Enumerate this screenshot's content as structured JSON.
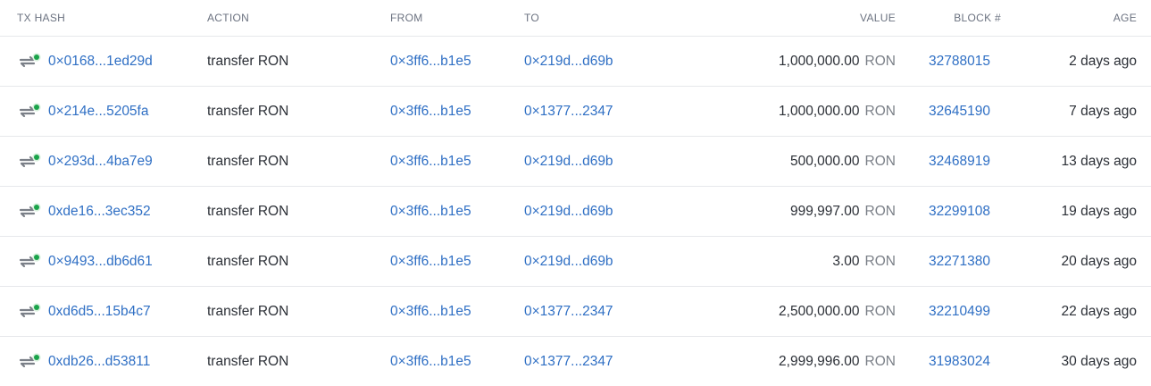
{
  "headers": {
    "tx_hash": "TX HASH",
    "action": "ACTION",
    "from": "FROM",
    "to": "TO",
    "value": "VALUE",
    "block": "BLOCK #",
    "age": "AGE"
  },
  "colors": {
    "link": "#2f6fc4",
    "status_success": "#1aa34a",
    "icon_gray": "#7a7f87"
  },
  "rows": [
    {
      "icon": "transfer-icon",
      "status": "success",
      "hash": "0×0168...1ed29d",
      "action": "transfer RON",
      "from": "0×3ff6...b1e5",
      "to": "0×219d...d69b",
      "value": "1,000,000.00",
      "unit": "RON",
      "block": "32788015",
      "age": "2 days ago"
    },
    {
      "icon": "transfer-icon",
      "status": "success",
      "hash": "0×214e...5205fa",
      "action": "transfer RON",
      "from": "0×3ff6...b1e5",
      "to": "0×1377...2347",
      "value": "1,000,000.00",
      "unit": "RON",
      "block": "32645190",
      "age": "7 days ago"
    },
    {
      "icon": "transfer-icon",
      "status": "success",
      "hash": "0×293d...4ba7e9",
      "action": "transfer RON",
      "from": "0×3ff6...b1e5",
      "to": "0×219d...d69b",
      "value": "500,000.00",
      "unit": "RON",
      "block": "32468919",
      "age": "13 days ago"
    },
    {
      "icon": "transfer-icon",
      "status": "success",
      "hash": "0xde16...3ec352",
      "action": "transfer RON",
      "from": "0×3ff6...b1e5",
      "to": "0×219d...d69b",
      "value": "999,997.00",
      "unit": "RON",
      "block": "32299108",
      "age": "19 days ago"
    },
    {
      "icon": "transfer-icon",
      "status": "success",
      "hash": "0×9493...db6d61",
      "action": "transfer RON",
      "from": "0×3ff6...b1e5",
      "to": "0×219d...d69b",
      "value": "3.00",
      "unit": "RON",
      "block": "32271380",
      "age": "20 days ago"
    },
    {
      "icon": "transfer-icon",
      "status": "success",
      "hash": "0xd6d5...15b4c7",
      "action": "transfer RON",
      "from": "0×3ff6...b1e5",
      "to": "0×1377...2347",
      "value": "2,500,000.00",
      "unit": "RON",
      "block": "32210499",
      "age": "22 days ago"
    },
    {
      "icon": "transfer-icon",
      "status": "success",
      "hash": "0xdb26...d53811",
      "action": "transfer RON",
      "from": "0×3ff6...b1e5",
      "to": "0×1377...2347",
      "value": "2,999,996.00",
      "unit": "RON",
      "block": "31983024",
      "age": "30 days ago"
    }
  ]
}
